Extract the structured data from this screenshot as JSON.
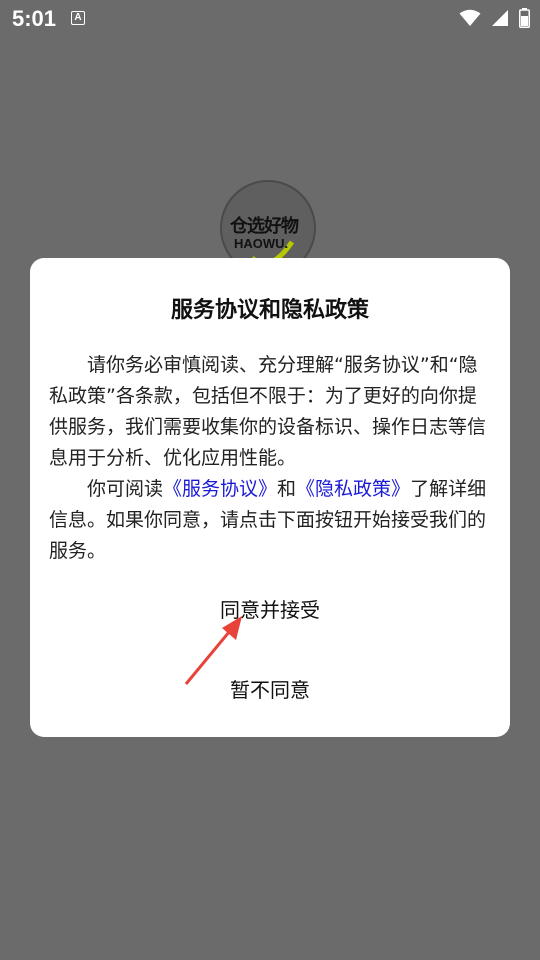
{
  "status_bar": {
    "time": "5:01",
    "notification_letter": "A",
    "icons": [
      "wifi-icon",
      "cellular-signal-icon",
      "battery-icon"
    ]
  },
  "logo": {
    "cn_text": "仓选好物",
    "en_text": "HAOWU."
  },
  "dialog": {
    "title": "服务协议和隐私政策",
    "paragraph1": "请你务必审慎阅读、充分理解“服务协议”和“隐私政策”各条款，包括但不限于：为了更好的向你提供服务，我们需要收集你的设备标识、操作日志等信息用于分析、优化应用性能。",
    "paragraph2_prefix": "你可阅读",
    "service_agreement_link": "《服务协议》",
    "paragraph2_middle": "和",
    "privacy_policy_link": "《隐私政策》",
    "paragraph2_suffix": "了解详细信息。如果你同意，请点击下面按钮开始接受我们的服务。",
    "accept_label": "同意并接受",
    "reject_label": "暂不同意"
  },
  "colors": {
    "overlay": "#6b6b6b",
    "link": "#1a1ad6",
    "annotation_arrow": "#e8423a"
  }
}
